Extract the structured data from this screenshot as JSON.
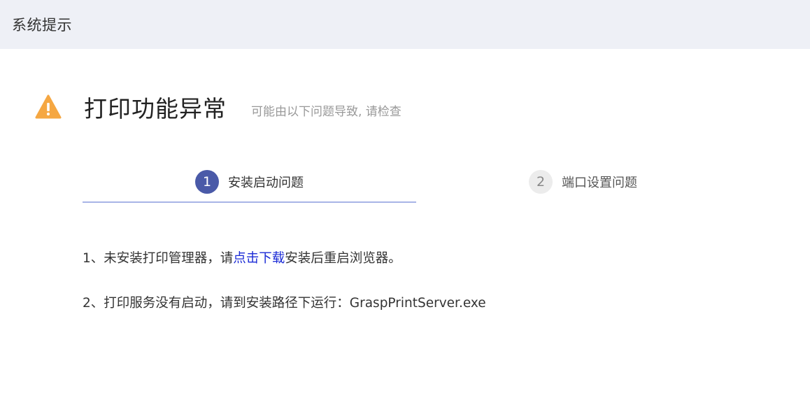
{
  "window": {
    "title": "系统提示"
  },
  "heading": {
    "icon": "warning-icon",
    "icon_color": "#f5a742",
    "title": "打印功能异常",
    "subtitle": "可能由以下问题导致, 请检查"
  },
  "steps": [
    {
      "number": "1",
      "label": "安装启动问题",
      "active": true
    },
    {
      "number": "2",
      "label": "端口设置问题",
      "active": false
    }
  ],
  "content": {
    "line1": {
      "prefix": "1、未安装打印管理器，请",
      "link": "点击下载",
      "suffix": "安装后重启浏览器。"
    },
    "line2": "2、打印服务没有启动，请到安装路径下运行：GraspPrintServer.exe"
  },
  "colors": {
    "accent": "#4a5aa8",
    "link": "#1a2ad6",
    "title_bar_bg": "#eef0f6"
  }
}
